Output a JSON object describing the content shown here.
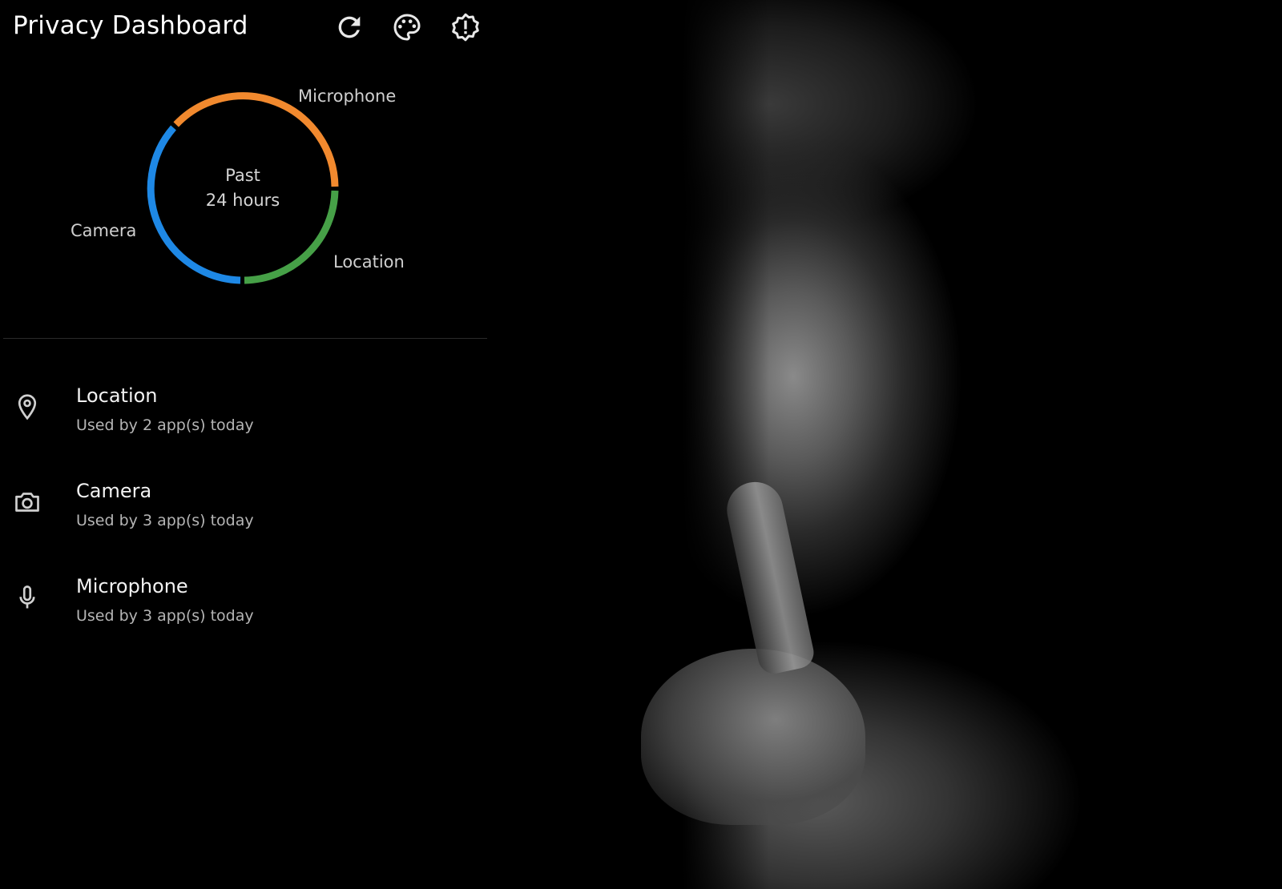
{
  "header": {
    "title": "Privacy Dashboard",
    "actions": [
      {
        "name": "refresh",
        "icon": "refresh-icon"
      },
      {
        "name": "theme",
        "icon": "palette-icon"
      },
      {
        "name": "feedback",
        "icon": "feedback-alert-icon"
      }
    ]
  },
  "summary": {
    "center_line1": "Past",
    "center_line2": "24 hours",
    "labels": {
      "microphone": "Microphone",
      "camera": "Camera",
      "location": "Location"
    },
    "colors": {
      "microphone": "#F1892E",
      "location": "#46A047",
      "camera": "#1E88E5"
    }
  },
  "permissions": [
    {
      "title": "Location",
      "subtitle": "Used by 2 app(s) today",
      "icon": "location-pin-icon"
    },
    {
      "title": "Camera",
      "subtitle": "Used by 3 app(s) today",
      "icon": "camera-icon"
    },
    {
      "title": "Microphone",
      "subtitle": "Used by 3 app(s) today",
      "icon": "microphone-icon"
    }
  ]
}
